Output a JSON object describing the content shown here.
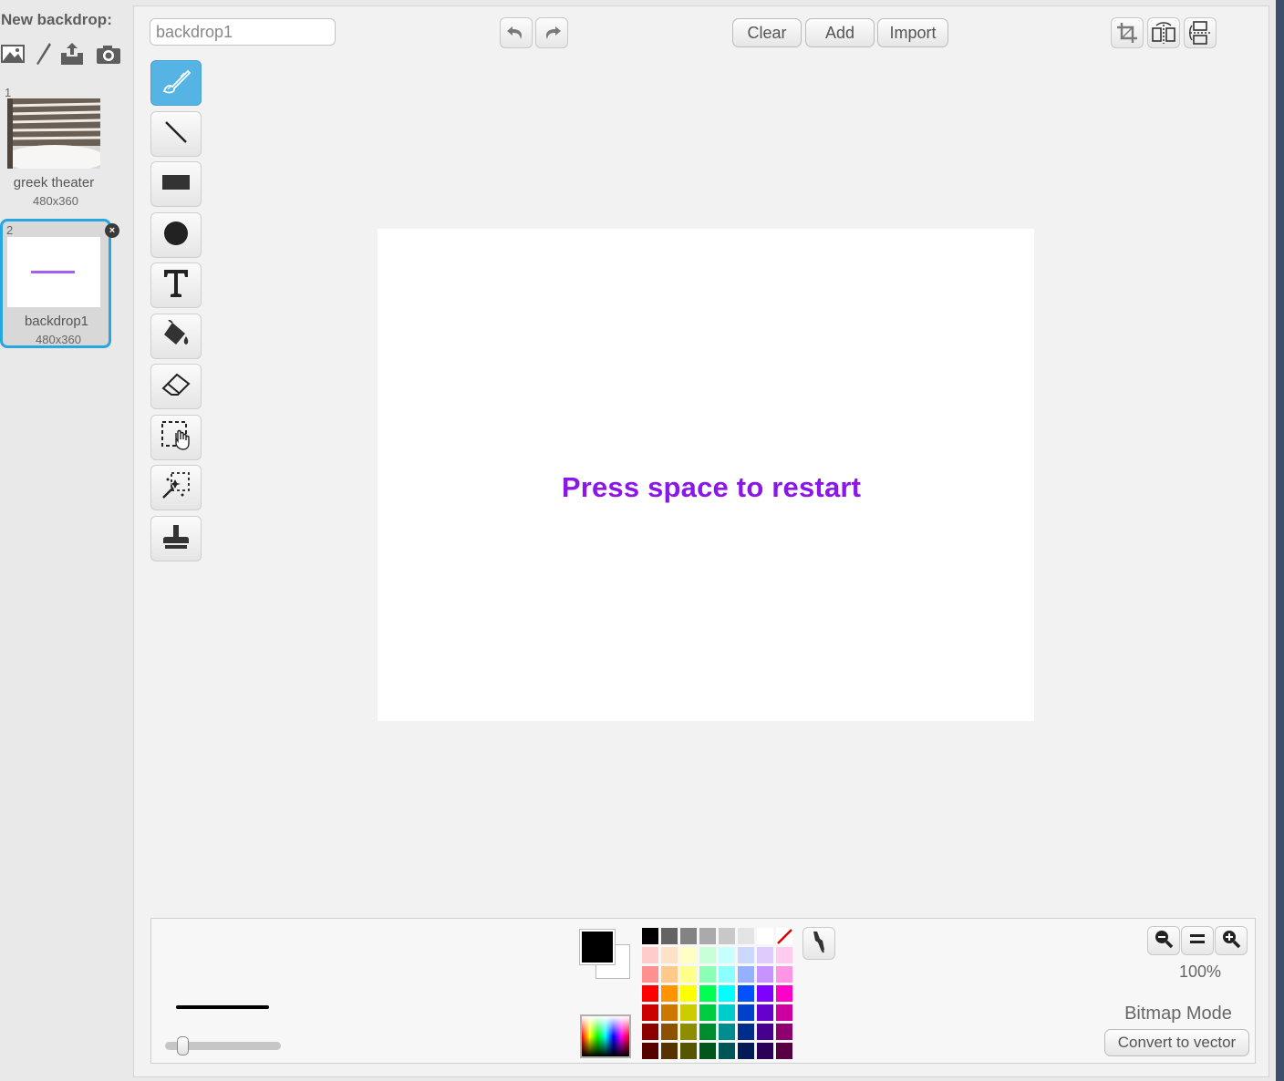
{
  "left_pane": {
    "title": "New backdrop:",
    "new_icons": [
      "choose-backdrop-library-icon",
      "paint-new-backdrop-icon",
      "upload-backdrop-icon",
      "camera-backdrop-icon"
    ],
    "backdrops": [
      {
        "number": "1",
        "name": "greek theater",
        "size": "480x360",
        "selected": false
      },
      {
        "number": "2",
        "name": "backdrop1",
        "size": "480x360",
        "selected": true
      }
    ]
  },
  "editor": {
    "costume_name": "backdrop1",
    "buttons": {
      "clear": "Clear",
      "add": "Add",
      "import": "Import"
    },
    "history_icons": [
      "undo-icon",
      "redo-icon"
    ],
    "transform_icons": [
      "crop-icon",
      "flip-horizontal-icon",
      "flip-vertical-icon"
    ],
    "tools": [
      "brush-icon",
      "line-icon",
      "rectangle-icon",
      "ellipse-icon",
      "text-icon",
      "fill-icon",
      "eraser-icon",
      "select-icon",
      "select-and-duplicate-icon",
      "stamp-icon"
    ],
    "selected_tool": "brush-icon",
    "canvas_text": "Press space to restart",
    "canvas_text_color": "#8a17e8"
  },
  "bottom": {
    "primary_color": "#000000",
    "secondary_color": "#ffffff",
    "zoom_level": "100%",
    "mode_label": "Bitmap Mode",
    "convert_button": "Convert to vector",
    "palette_rows": [
      [
        "#000000",
        "#636363",
        "#838383",
        "#aaaaaa",
        "#c8c8c8",
        "#e4e4e4",
        "#ffffff",
        "transparent"
      ],
      [
        "#ffcccc",
        "#ffe2c6",
        "#ffffc4",
        "#c8ffd8",
        "#c8ffff",
        "#cbd8ff",
        "#e0cbff",
        "#ffcbee"
      ],
      [
        "#ff9090",
        "#ffc98c",
        "#ffff8c",
        "#8cffb6",
        "#8cffff",
        "#94b0ff",
        "#c993ff",
        "#ff95e4"
      ],
      [
        "#ff0000",
        "#ff9400",
        "#ffff00",
        "#00ff51",
        "#00ffff",
        "#0051ff",
        "#8000ff",
        "#ff00c8"
      ],
      [
        "#cc0000",
        "#cc7700",
        "#cccc00",
        "#00cc41",
        "#00cccc",
        "#0041cc",
        "#6600cc",
        "#cc00a0"
      ],
      [
        "#8d0000",
        "#8d5200",
        "#8d8d00",
        "#008d2d",
        "#008d8d",
        "#002d8d",
        "#47008d",
        "#8d006e"
      ],
      [
        "#560000",
        "#563200",
        "#565600",
        "#00561b",
        "#005656",
        "#001b56",
        "#2b0056",
        "#560043"
      ]
    ]
  }
}
